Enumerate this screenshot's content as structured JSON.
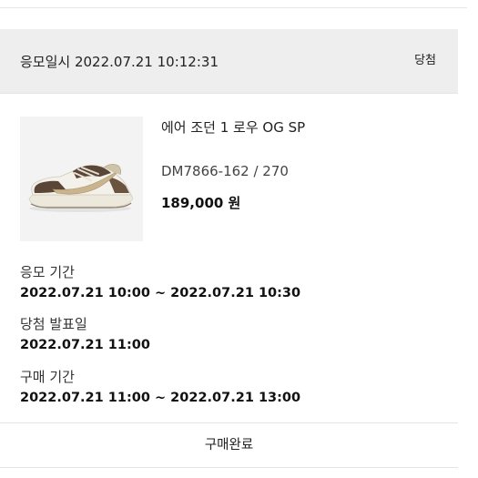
{
  "entry": {
    "date_text": "응모일시 2022.07.21 10:12:31",
    "status": "당첨"
  },
  "product": {
    "image_icon": "sneaker-image",
    "name": "에어 조던 1 로우 OG SP",
    "option": "DM7866-162 / 270",
    "price": "189,000 원"
  },
  "info": [
    {
      "label": "응모 기간",
      "value": "2022.07.21 10:00 ~ 2022.07.21 10:30"
    },
    {
      "label": "당첨 발표일",
      "value": "2022.07.21 11:00"
    },
    {
      "label": "구매 기간",
      "value": "2022.07.21 11:00 ~ 2022.07.21 13:00"
    }
  ],
  "action": {
    "label": "구매완료"
  }
}
